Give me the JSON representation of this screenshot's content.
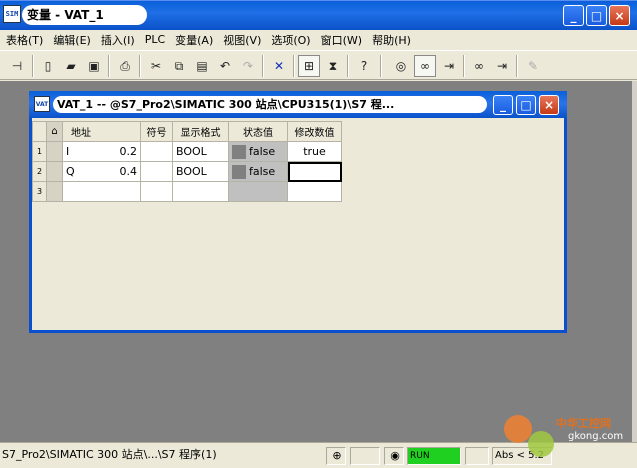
{
  "window": {
    "app_icon_text": "SIM",
    "title": "变量 - VAT_1",
    "minimize": "_",
    "maximize": "□",
    "close": "×"
  },
  "menu": [
    "表格(T)",
    "编辑(E)",
    "插入(I)",
    "PLC",
    "变量(A)",
    "视图(V)",
    "选项(O)",
    "窗口(W)",
    "帮助(H)"
  ],
  "toolbar": {
    "icons": [
      "pin-icon",
      "new-icon",
      "open-icon",
      "save-icon",
      "print-icon",
      "cut-icon",
      "copy-icon",
      "paste-icon",
      "undo-icon",
      "redo-icon",
      "delete-icon",
      "monitor-config-icon",
      "trigger-icon",
      "help-cursor-icon",
      "monitor-glasses-icon",
      "monitor-variable-icon",
      "modify-variable-icon",
      "update-monitor-icon",
      "update-modify-icon",
      "force-icon"
    ]
  },
  "child_window": {
    "icon_text": "VAT",
    "title": "VAT_1 -- @S7_Pro2\\SIMATIC 300 站点\\CPU315(1)\\S7 程...",
    "minimize": "_",
    "maximize": "□",
    "close": "×"
  },
  "table": {
    "headers": [
      "地址",
      "符号",
      "显示格式",
      "状态值",
      "修改数值"
    ],
    "rows": [
      {
        "num": "1",
        "address": "I",
        "addr_bit": "0.2",
        "symbol": "",
        "format": "BOOL",
        "status": "false",
        "modify": "true"
      },
      {
        "num": "2",
        "address": "Q",
        "addr_bit": "0.4",
        "symbol": "",
        "format": "BOOL",
        "status": "false",
        "modify": ""
      },
      {
        "num": "3",
        "address": "",
        "addr_bit": "",
        "symbol": "",
        "format": "",
        "status": "",
        "modify": ""
      }
    ]
  },
  "statusbar": {
    "path": "S7_Pro2\\SIMATIC 300 站点\\...\\S7 程序(1)",
    "mode": "RUN",
    "abs": "Abs < 5.2",
    "watermark": "中华工控网",
    "watermark_url": "gkong.com"
  }
}
